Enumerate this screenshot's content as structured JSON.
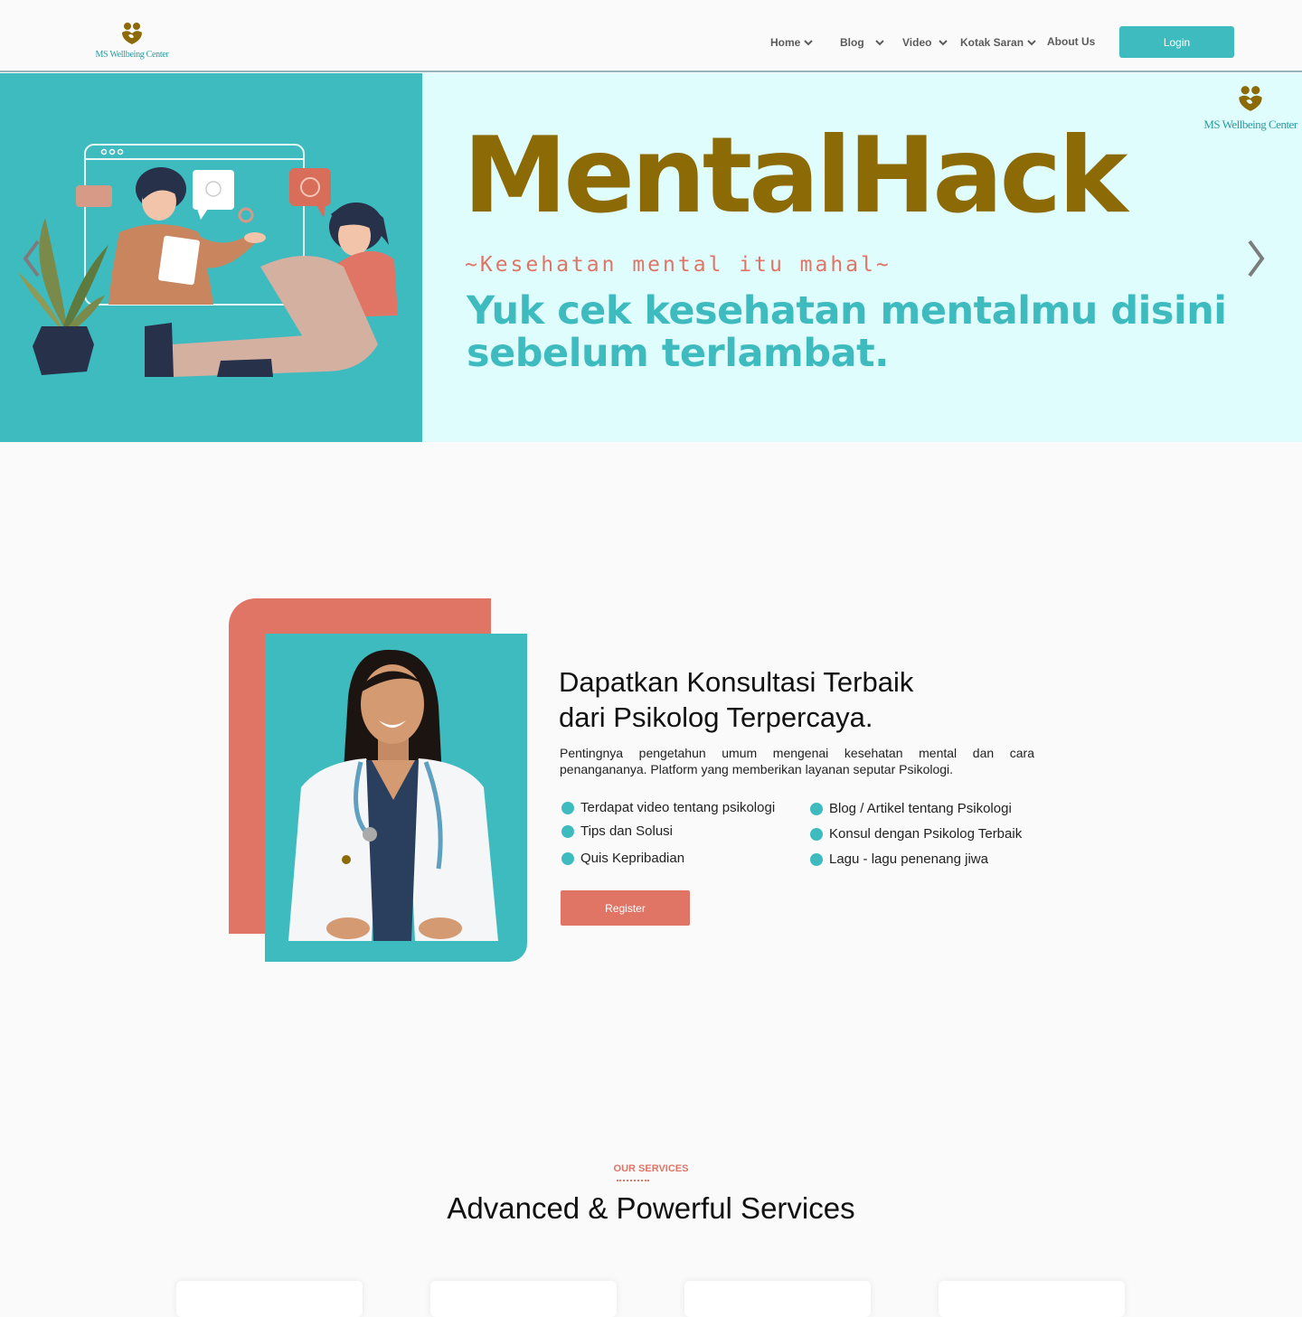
{
  "brand": {
    "name": "MS Wellbeing Center",
    "logo_color": "#8c6a06",
    "accent": "#3ebbbf",
    "coral": "#e07566"
  },
  "nav": {
    "items": [
      {
        "label": "Home",
        "icon": "chevron-down-icon"
      },
      {
        "label": "Blog",
        "icon": "chevron-down-icon"
      },
      {
        "label": "Video",
        "icon": "chevron-down-icon"
      },
      {
        "label": "Kotak Saran",
        "icon": "chevron-down-icon"
      },
      {
        "label": "About Us"
      }
    ],
    "login_label": "Login"
  },
  "hero": {
    "title": "MentalHack",
    "tagline": "~Kesehatan mental itu mahal~",
    "subtitle_line1": "Yuk cek kesehatan mentalmu disini",
    "subtitle_line2": "sebelum terlambat.",
    "logo_text": "MS Wellbeing Center",
    "prev_icon": "chevron-left-icon",
    "next_icon": "chevron-right-icon"
  },
  "about": {
    "title_line1": "Dapatkan Konsultasi Terbaik",
    "title_line2": "dari Psikolog Terpercaya.",
    "description": "Pentingnya pengetahun umum mengenai kesehatan mental dan cara penangananya. Platform yang memberikan layanan seputar Psikologi.",
    "features_left": [
      "Terdapat video tentang psikologi",
      "Tips dan Solusi",
      "Quis Kepribadian"
    ],
    "features_right": [
      "Blog / Artikel tentang Psikologi",
      "Konsul dengan Psikolog Terbaik",
      "Lagu - lagu penenang jiwa"
    ],
    "register_label": "Register"
  },
  "services": {
    "label": "OUR SERVICES",
    "title": "Advanced & Powerful Services"
  }
}
